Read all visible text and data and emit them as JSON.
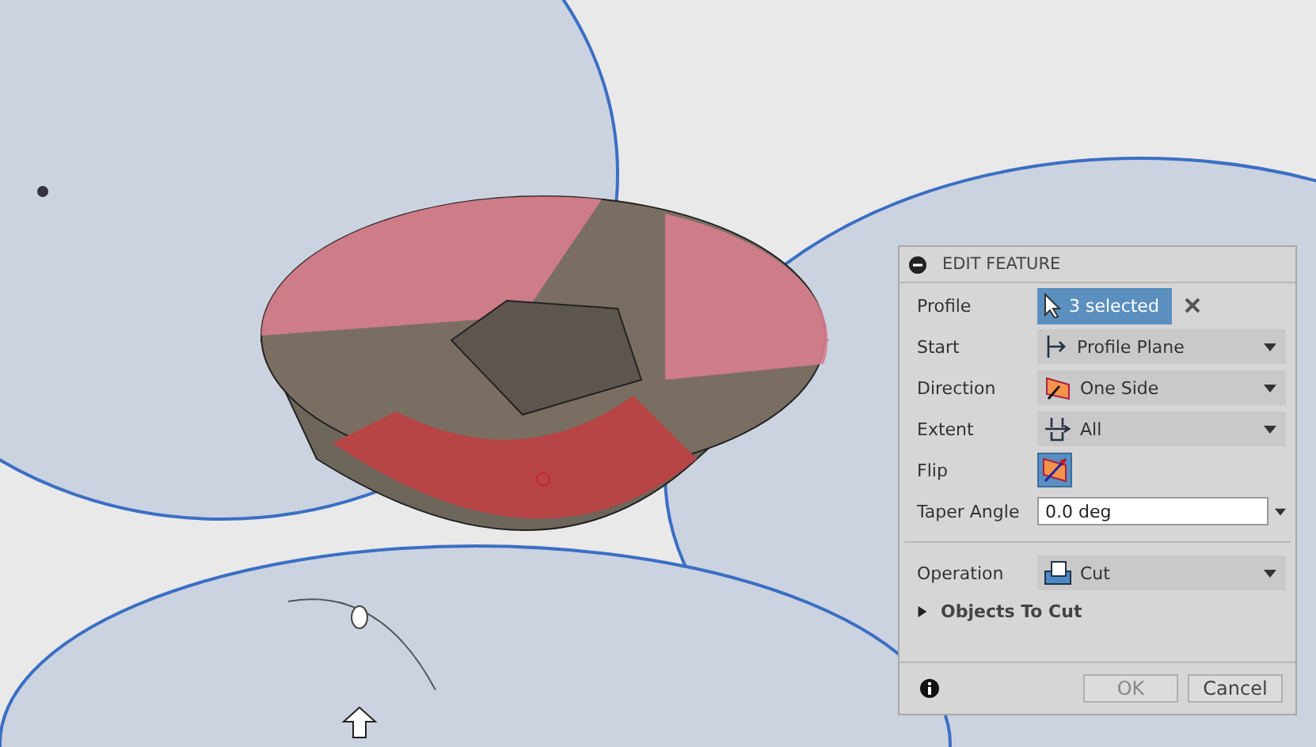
{
  "dialog": {
    "title": "EDIT FEATURE",
    "rows": [
      {
        "kind": "selection",
        "label": "Profile",
        "value": "3 selected"
      },
      {
        "kind": "dropdown",
        "label": "Start",
        "value": "Profile Plane"
      },
      {
        "kind": "dropdown",
        "label": "Direction",
        "value": "One Side"
      },
      {
        "kind": "dropdown",
        "label": "Extent",
        "value": "All"
      },
      {
        "kind": "toggle",
        "label": "Flip",
        "on": true
      },
      {
        "kind": "input",
        "label": "Taper Angle",
        "value": "0.0 deg"
      }
    ],
    "operation": {
      "label": "Operation",
      "value": "Cut"
    },
    "group": {
      "label": "Objects To Cut",
      "expanded": false
    },
    "buttons": [
      {
        "label": "OK",
        "disabled": true
      },
      {
        "label": "Cancel",
        "disabled": false
      }
    ]
  }
}
